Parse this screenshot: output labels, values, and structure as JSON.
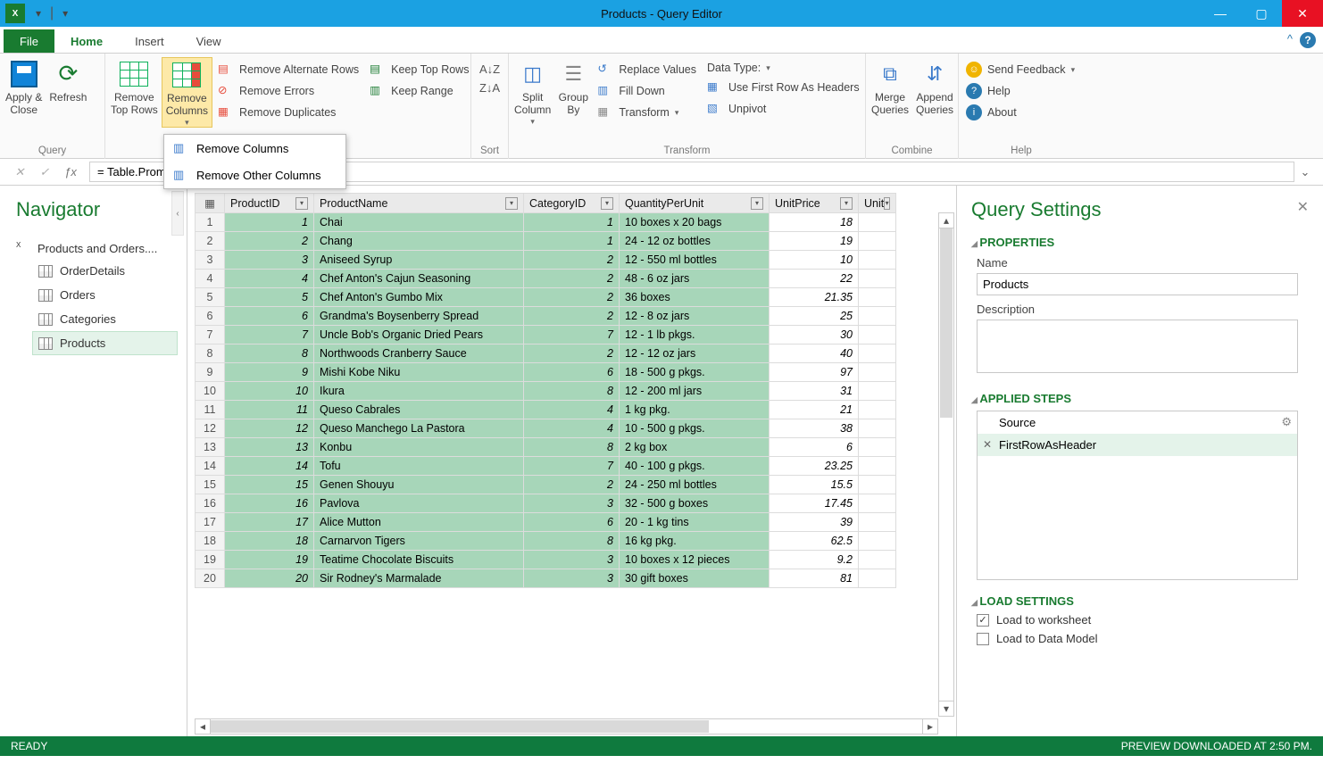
{
  "window": {
    "title": "Products - Query Editor",
    "status_ready": "READY",
    "status_right": "PREVIEW DOWNLOADED AT 2:50 PM."
  },
  "tabs": {
    "file": "File",
    "home": "Home",
    "insert": "Insert",
    "view": "View"
  },
  "ribbon": {
    "query": {
      "apply_close": "Apply &\nClose",
      "refresh": "Refresh",
      "label": "Query"
    },
    "cols": {
      "remove_top_rows": "Remove\nTop Rows",
      "remove_columns": "Remove\nColumns",
      "remove_alt": "Remove Alternate Rows",
      "remove_errors": "Remove Errors",
      "remove_dup": "Remove Duplicates",
      "keep_top": "Keep Top Rows",
      "keep_range": "Keep Range"
    },
    "sort": {
      "label": "Sort"
    },
    "transform": {
      "split": "Split\nColumn",
      "group": "Group\nBy",
      "replace": "Replace Values",
      "fill": "Fill Down",
      "transform": "Transform",
      "datatype": "Data Type:",
      "firstrow": "Use First Row As Headers",
      "unpivot": "Unpivot",
      "label": "Transform"
    },
    "combine": {
      "merge": "Merge\nQueries",
      "append": "Append\nQueries",
      "label": "Combine"
    },
    "help": {
      "feedback": "Send Feedback",
      "help": "Help",
      "about": "About",
      "label": "Help"
    }
  },
  "popup": {
    "remove_cols": "Remove Columns",
    "remove_other": "Remove Other Columns"
  },
  "fx": {
    "formula": "= Table.PromoteHeaders(Products)"
  },
  "nav": {
    "title": "Navigator",
    "db": "Products and Orders....",
    "tables": [
      "OrderDetails",
      "Orders",
      "Categories",
      "Products"
    ],
    "selected": "Products"
  },
  "grid": {
    "columns": [
      "ProductID",
      "ProductName",
      "CategoryID",
      "QuantityPerUnit",
      "UnitPrice",
      "Unit"
    ],
    "rows": [
      {
        "id": 1,
        "name": "Chai",
        "cat": 1,
        "qty": "10 boxes x 20 bags",
        "price": "18"
      },
      {
        "id": 2,
        "name": "Chang",
        "cat": 1,
        "qty": "24 - 12 oz bottles",
        "price": "19"
      },
      {
        "id": 3,
        "name": "Aniseed Syrup",
        "cat": 2,
        "qty": "12 - 550 ml bottles",
        "price": "10"
      },
      {
        "id": 4,
        "name": "Chef Anton's Cajun Seasoning",
        "cat": 2,
        "qty": "48 - 6 oz jars",
        "price": "22"
      },
      {
        "id": 5,
        "name": "Chef Anton's Gumbo Mix",
        "cat": 2,
        "qty": "36 boxes",
        "price": "21.35"
      },
      {
        "id": 6,
        "name": "Grandma's Boysenberry Spread",
        "cat": 2,
        "qty": "12 - 8 oz jars",
        "price": "25"
      },
      {
        "id": 7,
        "name": "Uncle Bob's Organic Dried Pears",
        "cat": 7,
        "qty": "12 - 1 lb pkgs.",
        "price": "30"
      },
      {
        "id": 8,
        "name": "Northwoods Cranberry Sauce",
        "cat": 2,
        "qty": "12 - 12 oz jars",
        "price": "40"
      },
      {
        "id": 9,
        "name": "Mishi Kobe Niku",
        "cat": 6,
        "qty": "18 - 500 g pkgs.",
        "price": "97"
      },
      {
        "id": 10,
        "name": "Ikura",
        "cat": 8,
        "qty": "12 - 200 ml jars",
        "price": "31"
      },
      {
        "id": 11,
        "name": "Queso Cabrales",
        "cat": 4,
        "qty": "1 kg pkg.",
        "price": "21"
      },
      {
        "id": 12,
        "name": "Queso Manchego La Pastora",
        "cat": 4,
        "qty": "10 - 500 g pkgs.",
        "price": "38"
      },
      {
        "id": 13,
        "name": "Konbu",
        "cat": 8,
        "qty": "2 kg box",
        "price": "6"
      },
      {
        "id": 14,
        "name": "Tofu",
        "cat": 7,
        "qty": "40 - 100 g pkgs.",
        "price": "23.25"
      },
      {
        "id": 15,
        "name": "Genen Shouyu",
        "cat": 2,
        "qty": "24 - 250 ml bottles",
        "price": "15.5"
      },
      {
        "id": 16,
        "name": "Pavlova",
        "cat": 3,
        "qty": "32 - 500 g boxes",
        "price": "17.45"
      },
      {
        "id": 17,
        "name": "Alice Mutton",
        "cat": 6,
        "qty": "20 - 1 kg tins",
        "price": "39"
      },
      {
        "id": 18,
        "name": "Carnarvon Tigers",
        "cat": 8,
        "qty": "16 kg pkg.",
        "price": "62.5"
      },
      {
        "id": 19,
        "name": "Teatime Chocolate Biscuits",
        "cat": 3,
        "qty": "10 boxes x 12 pieces",
        "price": "9.2"
      },
      {
        "id": 20,
        "name": "Sir Rodney's Marmalade",
        "cat": 3,
        "qty": "30 gift boxes",
        "price": "81"
      }
    ]
  },
  "qs": {
    "title": "Query Settings",
    "properties": "PROPERTIES",
    "name_label": "Name",
    "name_value": "Products",
    "desc_label": "Description",
    "applied": "APPLIED STEPS",
    "steps": [
      "Source",
      "FirstRowAsHeader"
    ],
    "load": "LOAD SETTINGS",
    "load_ws": "Load to worksheet",
    "load_dm": "Load to Data Model"
  }
}
